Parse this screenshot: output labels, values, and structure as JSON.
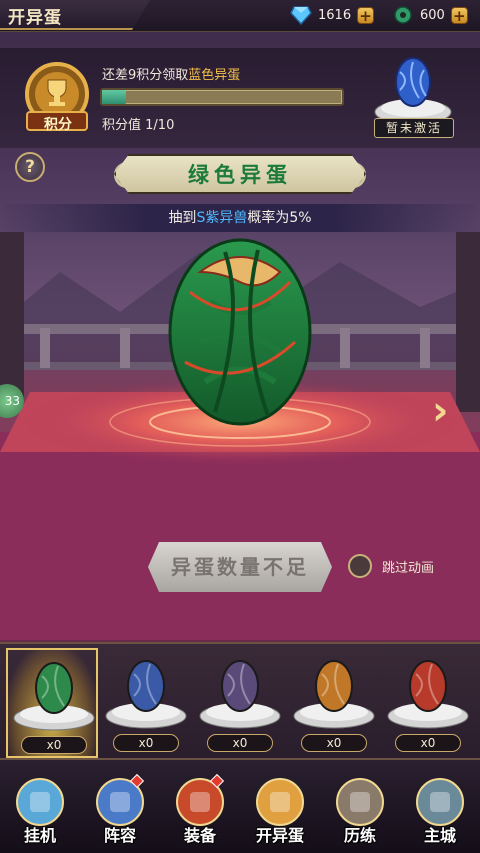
{
  "header": {
    "title": "开异蛋"
  },
  "currencies": [
    {
      "icon": "blue-gem-icon",
      "value": "1616"
    },
    {
      "icon": "green-jade-icon",
      "value": "600"
    }
  ],
  "score": {
    "badge_label": "积分",
    "hint_prefix": "还差9积分领取",
    "hint_highlight": "蓝色异蛋",
    "progress": 0.1,
    "score_label": "积分值",
    "score_value": "1/10",
    "reward_status": "暂未激活"
  },
  "egg": {
    "name": "绿色异蛋",
    "prob_prefix": "抽到",
    "prob_highlight": "S紫异兽",
    "prob_suffix": "概率为5%"
  },
  "side": {
    "badge_value": "33"
  },
  "actions": {
    "open_button": "异蛋数量不足",
    "skip_label": "跳过动画"
  },
  "egg_slots": [
    {
      "color": "#2e8a4a",
      "count": "x0",
      "selected": true
    },
    {
      "color": "#3a5aa8",
      "count": "x0",
      "selected": false
    },
    {
      "color": "#5a4a7a",
      "count": "x0",
      "selected": false
    },
    {
      "color": "#c07828",
      "count": "x0",
      "selected": false
    },
    {
      "color": "#b83a2a",
      "count": "x0",
      "selected": false
    }
  ],
  "nav": [
    {
      "label": "挂机",
      "badge": false
    },
    {
      "label": "阵容",
      "badge": true
    },
    {
      "label": "装备",
      "badge": true
    },
    {
      "label": "开异蛋",
      "badge": false
    },
    {
      "label": "历练",
      "badge": false
    },
    {
      "label": "主城",
      "badge": false
    }
  ]
}
